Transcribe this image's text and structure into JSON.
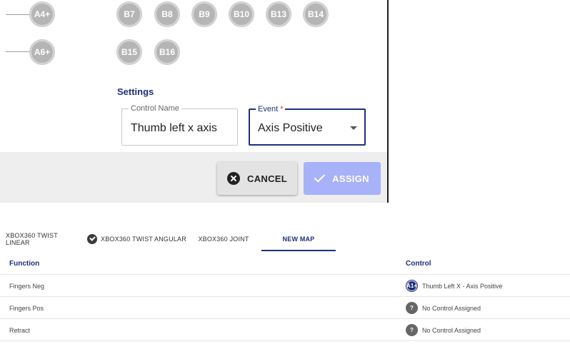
{
  "mapping_buttons": {
    "row1": {
      "left": "A4+",
      "right": [
        "B7",
        "B8",
        "B9",
        "B10",
        "B13",
        "B14"
      ]
    },
    "row2": {
      "left": "A6+",
      "right": [
        "B15",
        "B16"
      ]
    }
  },
  "settings": {
    "title": "Settings",
    "control_name": {
      "label": "Control Name",
      "value": "Thumb left x axis"
    },
    "event": {
      "label": "Event",
      "required_mark": "*",
      "value": "Axis Positive"
    }
  },
  "actions": {
    "cancel_label": "CANCEL",
    "assign_label": "ASSIGN"
  },
  "tabs": [
    {
      "label": "XBOX360 TWIST LINEAR",
      "has_check": true
    },
    {
      "label": "XBOX360 TWIST ANGULAR",
      "has_check": false
    },
    {
      "label": "XBOX360 JOINT",
      "has_check": false
    },
    {
      "label": "NEW MAP",
      "has_check": false,
      "active": true
    }
  ],
  "table": {
    "headers": {
      "function": "Function",
      "control": "Control"
    },
    "rows": [
      {
        "function": "Fingers Neg",
        "badge": "A1+",
        "control": "Thumb Left X - Axis Positive"
      },
      {
        "function": "Fingers Pos",
        "badge": "?",
        "control": "No Control Assigned"
      },
      {
        "function": "Retract",
        "badge": "?",
        "control": "No Control Assigned"
      }
    ]
  },
  "colors": {
    "accent": "#1f2f7a",
    "assign_button": "#a7b2f8",
    "footer_bg": "#eeeeee"
  }
}
